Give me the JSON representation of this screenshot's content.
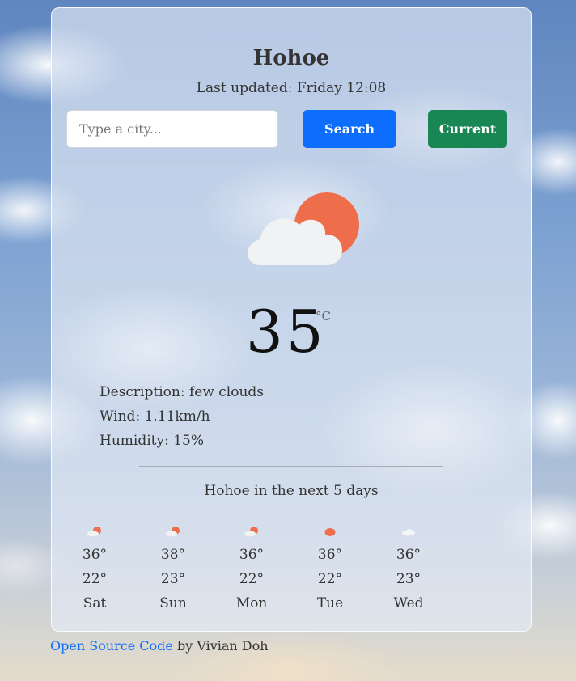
{
  "city": "Hohoe",
  "last_updated": "Last updated: Friday 12:08",
  "search": {
    "placeholder": "Type a city...",
    "value": "",
    "search_label": "Search",
    "current_label": "Current"
  },
  "current": {
    "icon": "few-clouds-icon",
    "temperature": "35",
    "unit": "°C",
    "description": "Description: few clouds",
    "wind": "Wind: 1.11km/h",
    "humidity": "Humidity: 15%"
  },
  "forecast_title": "Hohoe in the next 5 days",
  "forecast": [
    {
      "icon": "few-clouds-icon",
      "high": "36°",
      "low": "22°",
      "day": "Sat"
    },
    {
      "icon": "few-clouds-icon",
      "high": "38°",
      "low": "23°",
      "day": "Sun"
    },
    {
      "icon": "few-clouds-icon",
      "high": "36°",
      "low": "22°",
      "day": "Mon"
    },
    {
      "icon": "clear-sky-icon",
      "high": "36°",
      "low": "22°",
      "day": "Tue"
    },
    {
      "icon": "scattered-clouds-icon",
      "high": "36°",
      "low": "23°",
      "day": "Wed"
    }
  ],
  "footer": {
    "link_text": "Open Source Code",
    "author_text": " by Vivian Doh"
  },
  "colors": {
    "search_button": "#0d6efd",
    "current_button": "#198754",
    "sun": "#ee6e4c"
  }
}
